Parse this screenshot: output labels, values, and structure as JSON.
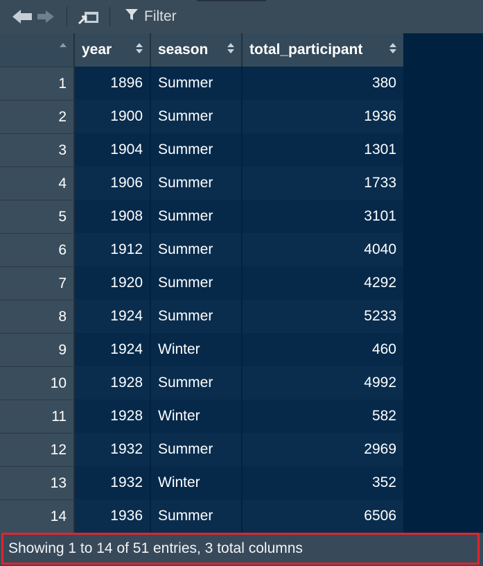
{
  "toolbar": {
    "back_icon": "arrow-left-icon",
    "forward_icon": "arrow-right-icon",
    "popout_icon": "popout-window-icon",
    "filter_icon": "filter-funnel-icon",
    "filter_label": "Filter"
  },
  "table": {
    "columns": [
      "year",
      "season",
      "total_participant"
    ],
    "rows": [
      {
        "n": "1",
        "year": "1896",
        "season": "Summer",
        "total": "380"
      },
      {
        "n": "2",
        "year": "1900",
        "season": "Summer",
        "total": "1936"
      },
      {
        "n": "3",
        "year": "1904",
        "season": "Summer",
        "total": "1301"
      },
      {
        "n": "4",
        "year": "1906",
        "season": "Summer",
        "total": "1733"
      },
      {
        "n": "5",
        "year": "1908",
        "season": "Summer",
        "total": "3101"
      },
      {
        "n": "6",
        "year": "1912",
        "season": "Summer",
        "total": "4040"
      },
      {
        "n": "7",
        "year": "1920",
        "season": "Summer",
        "total": "4292"
      },
      {
        "n": "8",
        "year": "1924",
        "season": "Summer",
        "total": "5233"
      },
      {
        "n": "9",
        "year": "1924",
        "season": "Winter",
        "total": "460"
      },
      {
        "n": "10",
        "year": "1928",
        "season": "Summer",
        "total": "4992"
      },
      {
        "n": "11",
        "year": "1928",
        "season": "Winter",
        "total": "582"
      },
      {
        "n": "12",
        "year": "1932",
        "season": "Summer",
        "total": "2969"
      },
      {
        "n": "13",
        "year": "1932",
        "season": "Winter",
        "total": "352"
      },
      {
        "n": "14",
        "year": "1936",
        "season": "Summer",
        "total": "6506"
      }
    ]
  },
  "status": {
    "text": "Showing 1 to 14 of 51 entries, 3 total columns",
    "highlight_color": "#e0252f"
  }
}
